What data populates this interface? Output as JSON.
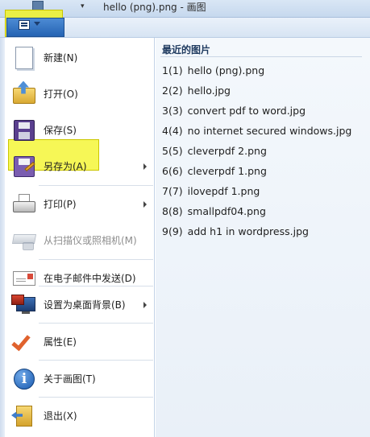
{
  "window": {
    "title": "hello (png).png - 画图"
  },
  "app_menu": {
    "items": [
      {
        "label": "新建(N)",
        "icon": "new-file-icon",
        "has_submenu": false,
        "enabled": true
      },
      {
        "label": "打开(O)",
        "icon": "open-folder-icon",
        "has_submenu": false,
        "enabled": true
      },
      {
        "label": "保存(S)",
        "icon": "save-disk-icon",
        "has_submenu": false,
        "enabled": true
      },
      {
        "label": "另存为(A)",
        "icon": "save-as-icon",
        "has_submenu": true,
        "enabled": true
      },
      {
        "label": "打印(P)",
        "icon": "printer-icon",
        "has_submenu": true,
        "enabled": true
      },
      {
        "label": "从扫描仪或照相机(M)",
        "icon": "scanner-icon",
        "has_submenu": false,
        "enabled": false
      },
      {
        "label": "在电子邮件中发送(D)",
        "icon": "email-icon",
        "has_submenu": false,
        "enabled": true
      },
      {
        "label": "设置为桌面背景(B)",
        "icon": "desktop-background-icon",
        "has_submenu": true,
        "enabled": true
      },
      {
        "label": "属性(E)",
        "icon": "properties-check-icon",
        "has_submenu": false,
        "enabled": true
      },
      {
        "label": "关于画图(T)",
        "icon": "info-icon",
        "has_submenu": false,
        "enabled": true
      },
      {
        "label": "退出(X)",
        "icon": "exit-icon",
        "has_submenu": false,
        "enabled": true
      }
    ]
  },
  "recent": {
    "title": "最近的图片",
    "items": [
      {
        "num": "1(1)",
        "name": "hello (png).png"
      },
      {
        "num": "2(2)",
        "name": "hello.jpg"
      },
      {
        "num": "3(3)",
        "name": "convert pdf to word.jpg"
      },
      {
        "num": "4(4)",
        "name": "no internet secured windows.jpg"
      },
      {
        "num": "5(5)",
        "name": "cleverpdf 2.png"
      },
      {
        "num": "6(6)",
        "name": "cleverpdf 1.png"
      },
      {
        "num": "7(7)",
        "name": "ilovepdf 1.png"
      },
      {
        "num": "8(8)",
        "name": "smallpdf04.png"
      },
      {
        "num": "9(9)",
        "name": "add h1 in wordpress.jpg"
      }
    ]
  },
  "colors": {
    "highlight": "#f4f638",
    "app_button": "#2f6fbf"
  }
}
